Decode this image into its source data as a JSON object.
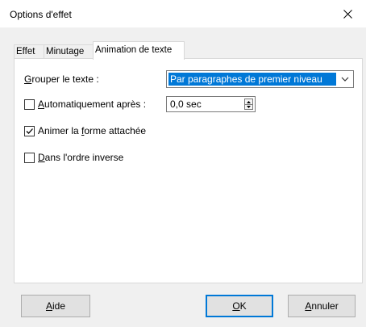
{
  "window": {
    "title": "Options d'effet"
  },
  "tabs": [
    {
      "label": "Effet",
      "active": false
    },
    {
      "label": "Minutage",
      "active": false
    },
    {
      "label": "Animation de texte",
      "active": true
    }
  ],
  "panel": {
    "group_text": {
      "label_mnemonic": "G",
      "label_rest": "rouper le texte :",
      "selected": "Par paragraphes de premier niveau"
    },
    "auto_after": {
      "checked": false,
      "label_mnemonic": "A",
      "label_rest": "utomatiquement après :",
      "value": "0,0 sec"
    },
    "animate_shape": {
      "checked": true,
      "label_before": "Animer la ",
      "label_mnemonic": "f",
      "label_after": "orme attachée"
    },
    "reverse_order": {
      "checked": false,
      "label_mnemonic": "D",
      "label_rest": "ans l'ordre inverse"
    }
  },
  "buttons": {
    "help_mnemonic": "A",
    "help_rest": "ide",
    "ok_mnemonic": "O",
    "ok_rest": "K",
    "cancel_mnemonic": "A",
    "cancel_rest": "nnuler"
  },
  "colors": {
    "selection": "#0078d7",
    "panel_border": "#d9d9d9",
    "dialog_bg": "#f0f0f0"
  },
  "icons": {
    "close": "close-icon",
    "combo_arrow": "chevron-down-icon",
    "spin_up": "triangle-up-icon",
    "spin_down": "triangle-down-icon",
    "check": "checkmark-icon"
  }
}
